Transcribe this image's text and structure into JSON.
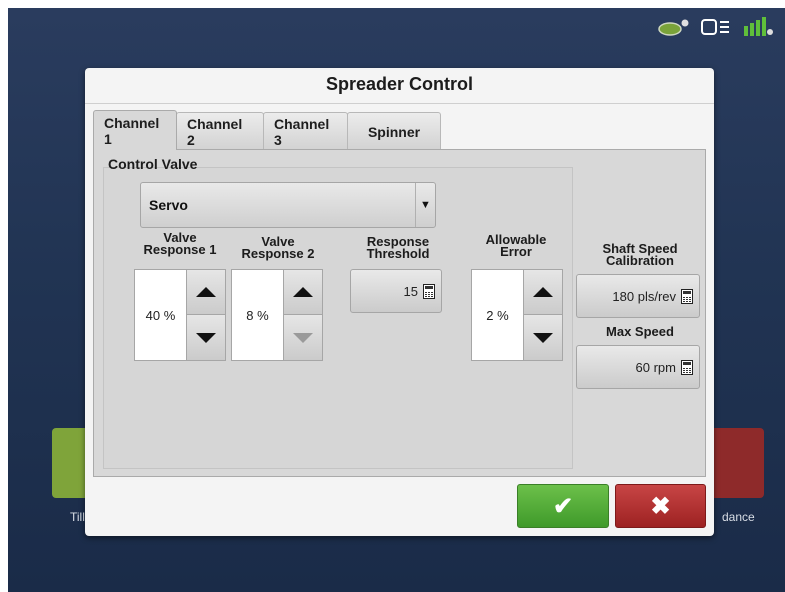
{
  "dialog": {
    "title": "Spreader Control"
  },
  "tabs": [
    {
      "label": "Channel 1",
      "active": true
    },
    {
      "label": "Channel 2"
    },
    {
      "label": "Channel 3"
    },
    {
      "label": "Spinner"
    }
  ],
  "control_valve": {
    "section_label": "Control Valve",
    "selected": "Servo"
  },
  "valve_response_1": {
    "label_line1": "Valve",
    "label_line2": "Response 1",
    "value": "40 %"
  },
  "valve_response_2": {
    "label_line1": "Valve",
    "label_line2": "Response 2",
    "value": "8 %"
  },
  "response_threshold": {
    "label_line1": "Response",
    "label_line2": "Threshold",
    "value": "15"
  },
  "allowable_error": {
    "label_line1": "Allowable",
    "label_line2": "Error",
    "value": "2 %"
  },
  "shaft_speed_calibration": {
    "label_line1": "Shaft Speed",
    "label_line2": "Calibration",
    "value": "180 pls/rev"
  },
  "max_speed": {
    "label": "Max Speed",
    "value": "60 rpm"
  },
  "background": {
    "left_tile_label": "Tilla",
    "right_tile_label": "dance"
  },
  "buttons": {
    "ok_glyph": "✔",
    "cancel_glyph": "✖"
  },
  "colors": {
    "accept": "#4fae35",
    "cancel": "#b23131",
    "background": "#213453"
  }
}
